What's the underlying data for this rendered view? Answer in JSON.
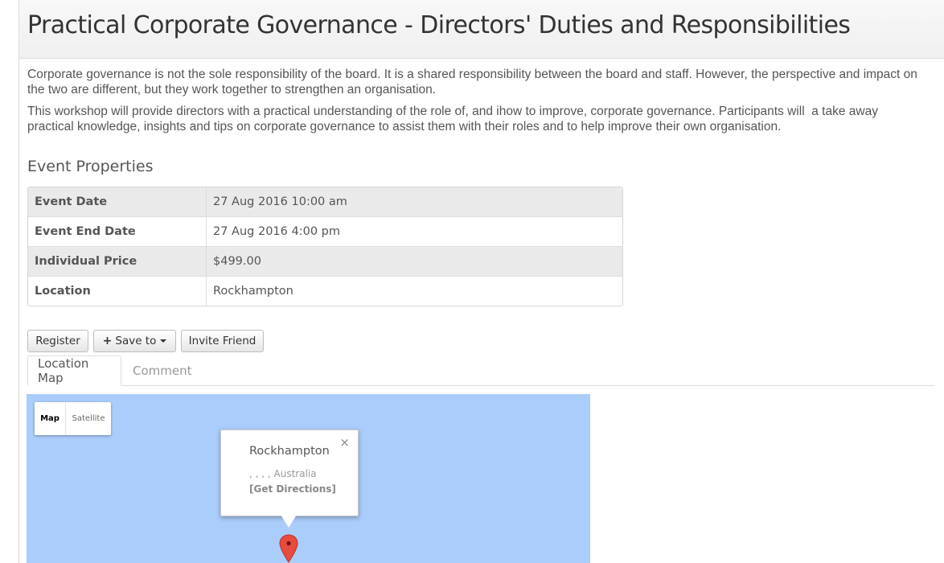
{
  "page": {
    "title": "Practical Corporate Governance - Directors' Duties and Responsibilities",
    "description": [
      "Corporate governance is not the sole responsibility of the board. It is a shared responsibility between the board and staff. However, the perspective and impact on the two are different, but they work together to strengthen an organisation.",
      "This workshop will provide directors with a practical understanding of the role of, and ihow to improve, corporate governance. Participants will  a take away practical knowledge, insights and tips on corporate governance to assist them with their roles and to help improve their own organisation."
    ]
  },
  "properties": {
    "heading": "Event Properties",
    "rows": [
      {
        "label": "Event Date",
        "value": "27 Aug 2016 10:00 am"
      },
      {
        "label": "Event End Date",
        "value": "27 Aug 2016 4:00 pm"
      },
      {
        "label": "Individual Price",
        "value": "$499.00"
      },
      {
        "label": "Location",
        "value": "Rockhampton"
      }
    ]
  },
  "actions": {
    "register": "Register",
    "save_to": "Save to",
    "invite_friend": "Invite Friend"
  },
  "tabs": [
    {
      "label": "Location Map",
      "active": true
    },
    {
      "label": "Comment",
      "active": false
    }
  ],
  "map": {
    "type_controls": {
      "map": "Map",
      "satellite": "Satellite"
    },
    "selected_type": "Map",
    "infowindow": {
      "title": "Rockhampton",
      "address": ", , , , Australia",
      "directions": "[Get Directions]",
      "close": "×"
    },
    "water_color": "#abcdfb",
    "marker_color": "#e84c3d",
    "marker_icon": "map-pin-icon"
  }
}
